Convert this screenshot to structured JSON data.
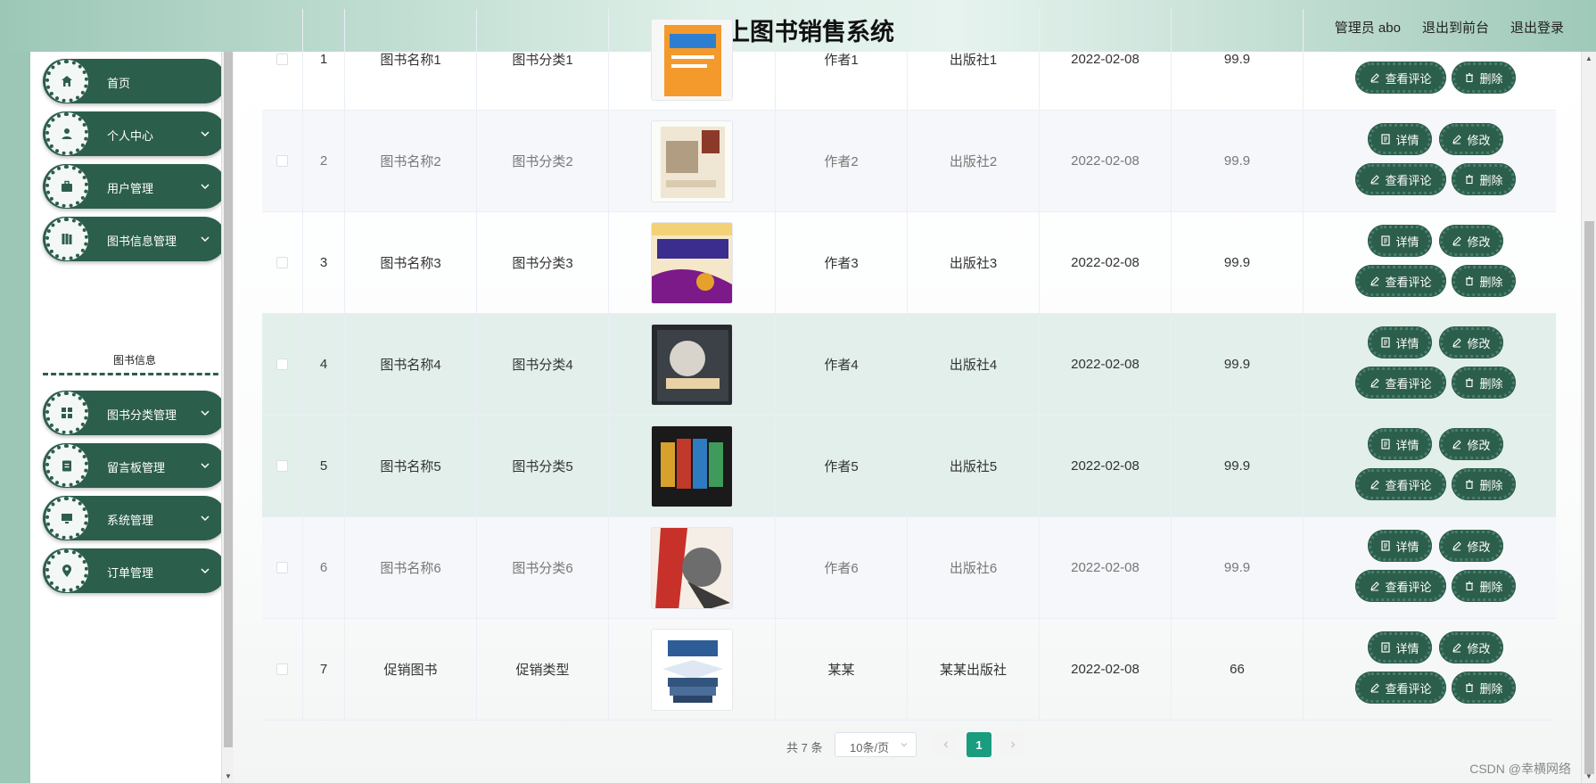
{
  "header": {
    "title": "网上图书销售系统",
    "admin": "管理员 abo",
    "exit_front": "退出到前台",
    "logout": "退出登录"
  },
  "sidebar": {
    "items": [
      {
        "label": "首页",
        "icon": "home-icon",
        "has_chevron": false
      },
      {
        "label": "个人中心",
        "icon": "user-icon",
        "has_chevron": true
      },
      {
        "label": "用户管理",
        "icon": "briefcase-icon",
        "has_chevron": true
      },
      {
        "label": "图书信息管理",
        "icon": "book-icon",
        "has_chevron": true
      },
      {
        "label": "图书分类管理",
        "icon": "grid-icon",
        "has_chevron": true
      },
      {
        "label": "留言板管理",
        "icon": "clipboard-icon",
        "has_chevron": true
      },
      {
        "label": "系统管理",
        "icon": "monitor-icon",
        "has_chevron": true
      },
      {
        "label": "订单管理",
        "icon": "location-icon",
        "has_chevron": true
      }
    ],
    "submenu_label": "图书信息"
  },
  "table": {
    "rows": [
      {
        "no": "1",
        "name": "图书名称1",
        "category": "图书分类1",
        "author": "作者1",
        "publisher": "出版社1",
        "date": "2022-02-08",
        "price": "99.9"
      },
      {
        "no": "2",
        "name": "图书名称2",
        "category": "图书分类2",
        "author": "作者2",
        "publisher": "出版社2",
        "date": "2022-02-08",
        "price": "99.9"
      },
      {
        "no": "3",
        "name": "图书名称3",
        "category": "图书分类3",
        "author": "作者3",
        "publisher": "出版社3",
        "date": "2022-02-08",
        "price": "99.9"
      },
      {
        "no": "4",
        "name": "图书名称4",
        "category": "图书分类4",
        "author": "作者4",
        "publisher": "出版社4",
        "date": "2022-02-08",
        "price": "99.9"
      },
      {
        "no": "5",
        "name": "图书名称5",
        "category": "图书分类5",
        "author": "作者5",
        "publisher": "出版社5",
        "date": "2022-02-08",
        "price": "99.9"
      },
      {
        "no": "6",
        "name": "图书名称6",
        "category": "图书分类6",
        "author": "作者6",
        "publisher": "出版社6",
        "date": "2022-02-08",
        "price": "99.9"
      },
      {
        "no": "7",
        "name": "促销图书",
        "category": "促销类型",
        "author": "某某",
        "publisher": "某某出版社",
        "date": "2022-02-08",
        "price": "66"
      }
    ],
    "actions": {
      "detail": "详情",
      "edit": "修改",
      "comments": "查看评论",
      "delete": "删除"
    }
  },
  "pagination": {
    "total": "共 7 条",
    "page_size": "10条/页",
    "current_page": "1"
  },
  "colors": {
    "accent": "#2c5e4c",
    "page_active": "#1a9c7e"
  },
  "watermark": "CSDN @幸横网络"
}
